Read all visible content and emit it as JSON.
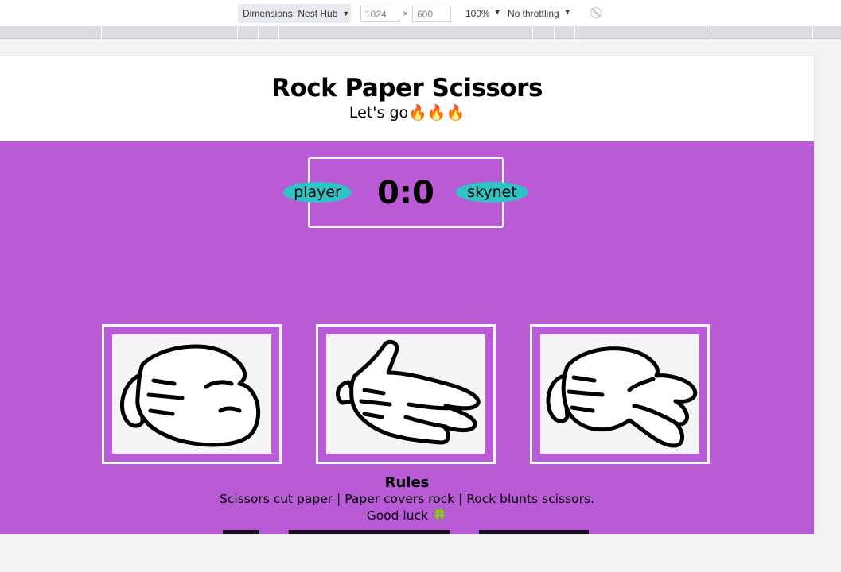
{
  "devtools": {
    "dimensions_label": "Dimensions: Nest Hub",
    "width_value": "1024",
    "height_value": "600",
    "times": "×",
    "zoom": "100%",
    "throttling": "No throttling",
    "caret": "▼"
  },
  "page": {
    "title": "Rock Paper Scissors",
    "subtitle": "Let's go🔥🔥🔥",
    "score": {
      "player_label": "player",
      "skynet_label": "skynet",
      "value": "0:0"
    },
    "choices": [
      {
        "name": "rock"
      },
      {
        "name": "paper"
      },
      {
        "name": "scissors"
      }
    ],
    "rules": {
      "title": "Rules",
      "text": "Scissors cut paper | Paper covers rock | Rock blunts scissors.",
      "luck": "Good luck",
      "clover": "🍀"
    }
  },
  "colors": {
    "purple": "#b95bd6",
    "badge": "#2ec4c4",
    "white": "#ffffff"
  }
}
